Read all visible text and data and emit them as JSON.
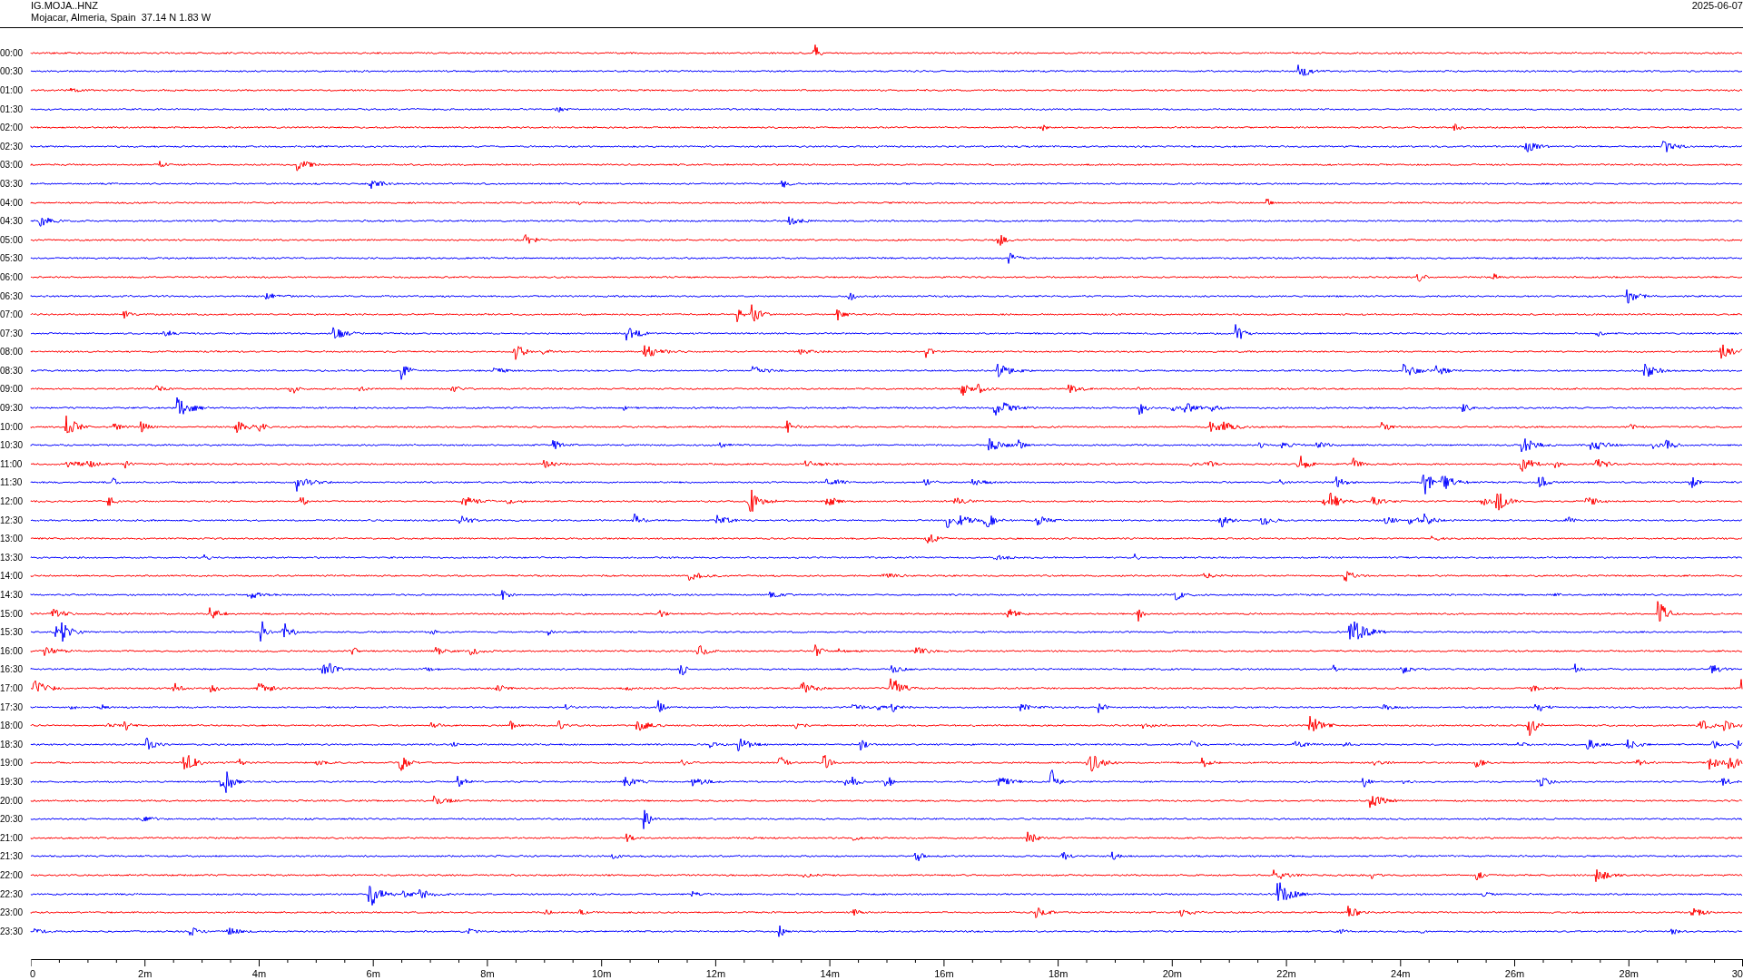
{
  "header": {
    "station": "IG.MOJA..HNZ",
    "location": "Mojacar, Almeria, Spain  37.14 N 1.83 W",
    "date": "2025-06-07"
  },
  "traces": [
    {
      "label": "00:00",
      "color": "#ff0000"
    },
    {
      "label": "00:30",
      "color": "#0000ff"
    },
    {
      "label": "01:00",
      "color": "#ff0000"
    },
    {
      "label": "01:30",
      "color": "#0000ff"
    },
    {
      "label": "02:00",
      "color": "#ff0000"
    },
    {
      "label": "02:30",
      "color": "#0000ff"
    },
    {
      "label": "03:00",
      "color": "#ff0000"
    },
    {
      "label": "03:30",
      "color": "#0000ff"
    },
    {
      "label": "04:00",
      "color": "#ff0000"
    },
    {
      "label": "04:30",
      "color": "#0000ff"
    },
    {
      "label": "05:00",
      "color": "#ff0000"
    },
    {
      "label": "05:30",
      "color": "#0000ff"
    },
    {
      "label": "06:00",
      "color": "#ff0000"
    },
    {
      "label": "06:30",
      "color": "#0000ff"
    },
    {
      "label": "07:00",
      "color": "#ff0000"
    },
    {
      "label": "07:30",
      "color": "#0000ff"
    },
    {
      "label": "08:00",
      "color": "#ff0000"
    },
    {
      "label": "08:30",
      "color": "#0000ff"
    },
    {
      "label": "09:00",
      "color": "#ff0000"
    },
    {
      "label": "09:30",
      "color": "#0000ff"
    },
    {
      "label": "10:00",
      "color": "#ff0000"
    },
    {
      "label": "10:30",
      "color": "#0000ff"
    },
    {
      "label": "11:00",
      "color": "#ff0000"
    },
    {
      "label": "11:30",
      "color": "#0000ff"
    },
    {
      "label": "12:00",
      "color": "#ff0000"
    },
    {
      "label": "12:30",
      "color": "#0000ff"
    },
    {
      "label": "13:00",
      "color": "#ff0000"
    },
    {
      "label": "13:30",
      "color": "#0000ff"
    },
    {
      "label": "14:00",
      "color": "#ff0000"
    },
    {
      "label": "14:30",
      "color": "#0000ff"
    },
    {
      "label": "15:00",
      "color": "#ff0000"
    },
    {
      "label": "15:30",
      "color": "#0000ff"
    },
    {
      "label": "16:00",
      "color": "#ff0000"
    },
    {
      "label": "16:30",
      "color": "#0000ff"
    },
    {
      "label": "17:00",
      "color": "#ff0000"
    },
    {
      "label": "17:30",
      "color": "#0000ff"
    },
    {
      "label": "18:00",
      "color": "#ff0000"
    },
    {
      "label": "18:30",
      "color": "#0000ff"
    },
    {
      "label": "19:00",
      "color": "#ff0000"
    },
    {
      "label": "19:30",
      "color": "#0000ff"
    },
    {
      "label": "20:00",
      "color": "#ff0000"
    },
    {
      "label": "20:30",
      "color": "#0000ff"
    },
    {
      "label": "21:00",
      "color": "#ff0000"
    },
    {
      "label": "21:30",
      "color": "#0000ff"
    },
    {
      "label": "22:00",
      "color": "#ff0000"
    },
    {
      "label": "22:30",
      "color": "#0000ff"
    },
    {
      "label": "23:00",
      "color": "#ff0000"
    },
    {
      "label": "23:30",
      "color": "#0000ff"
    }
  ],
  "time_axis": {
    "labels": [
      "0",
      "2m",
      "4m",
      "6m",
      "8m",
      "10m",
      "12m",
      "14m",
      "16m",
      "18m",
      "20m",
      "22m",
      "24m",
      "26m",
      "28m",
      "30"
    ]
  }
}
